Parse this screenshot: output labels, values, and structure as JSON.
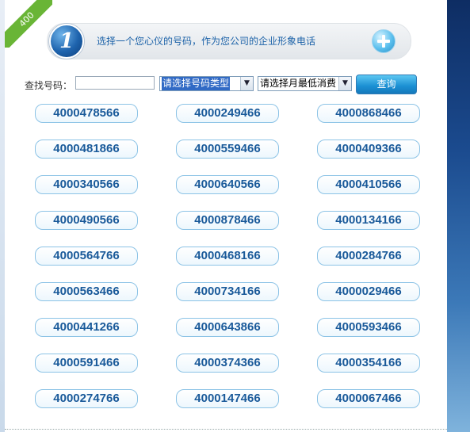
{
  "ribbon": {
    "label": "400"
  },
  "banner": {
    "step_number": "1",
    "text": "选择一个您心仪的号码，作为您公司的企业形象电话"
  },
  "search": {
    "label": "查找号码：",
    "input_value": "",
    "type_select": "请选择号码类型",
    "fee_select": "请选择月最低消费",
    "query_button": "查询"
  },
  "numbers": [
    [
      "4000478566",
      "4000249466",
      "4000868466"
    ],
    [
      "4000481866",
      "4000559466",
      "4000409366"
    ],
    [
      "4000340566",
      "4000640566",
      "4000410566"
    ],
    [
      "4000490566",
      "4000878466",
      "4000134166"
    ],
    [
      "4000564766",
      "4000468166",
      "4000284766"
    ],
    [
      "4000563466",
      "4000734166",
      "4000029466"
    ],
    [
      "4000441266",
      "4000643866",
      "4000593466"
    ],
    [
      "4000591466",
      "4000374366",
      "4000354166"
    ],
    [
      "4000274766",
      "4000147466",
      "4000067466"
    ]
  ]
}
